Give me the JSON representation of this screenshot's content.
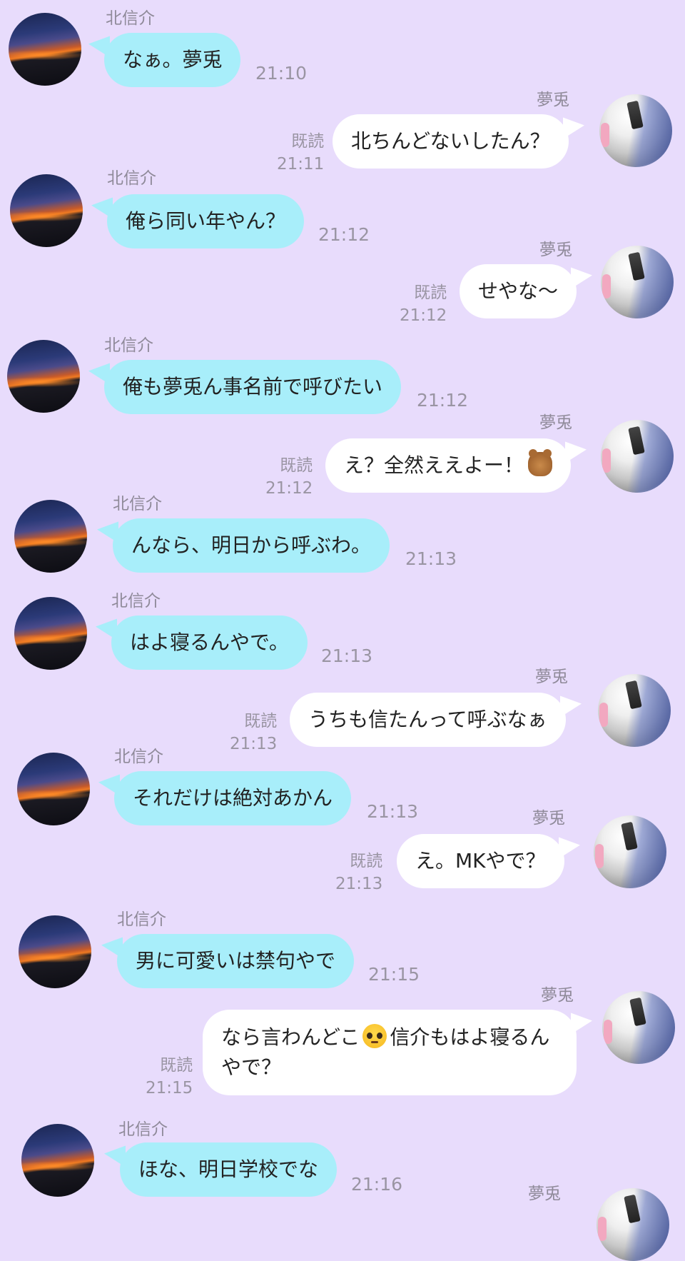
{
  "contacts": {
    "other_name": "北信介",
    "self_name": "夢兎"
  },
  "messages": [
    {
      "side": "left",
      "text": "なぁ。夢兎",
      "time": "21:10"
    },
    {
      "side": "right",
      "text": "北ちんどないしたん？",
      "read": "既読",
      "time": "21:11"
    },
    {
      "side": "left",
      "text": "俺ら同い年やん？",
      "time": "21:12"
    },
    {
      "side": "right",
      "text": "せやな〜",
      "read": "既読",
      "time": "21:12"
    },
    {
      "side": "left",
      "text": "俺も夢兎ん事名前で呼びたい",
      "time": "21:12"
    },
    {
      "side": "right",
      "text": "え？全然ええよー！",
      "emoji": "teddy-bear",
      "read": "既読",
      "time": "21:12"
    },
    {
      "side": "left",
      "text": "んなら、明日から呼ぶわ。",
      "time": "21:13"
    },
    {
      "side": "left",
      "text": "はよ寝るんやで。",
      "time": "21:13"
    },
    {
      "side": "right",
      "text": "うちも信たんって呼ぶなぁ",
      "read": "既読",
      "time": "21:13"
    },
    {
      "side": "left",
      "text": "それだけは絶対あかん",
      "time": "21:13"
    },
    {
      "side": "right",
      "text": "え。MKやで？",
      "read": "既読",
      "time": "21:13"
    },
    {
      "side": "left",
      "text": "男に可愛いは禁句やで",
      "time": "21:15"
    },
    {
      "side": "right",
      "text_before": "なら言わんどこ",
      "emoji": "pleading-face",
      "text_after": "信介もはよ寝るんやで？",
      "read": "既読",
      "time": "21:15"
    },
    {
      "side": "left",
      "text": "ほな、明日学校でな",
      "time": "21:16"
    }
  ],
  "colors": {
    "background": "#e8dcfc",
    "left_bubble": "#a8eefa",
    "right_bubble": "#ffffff",
    "meta_text": "#9a95a3"
  }
}
